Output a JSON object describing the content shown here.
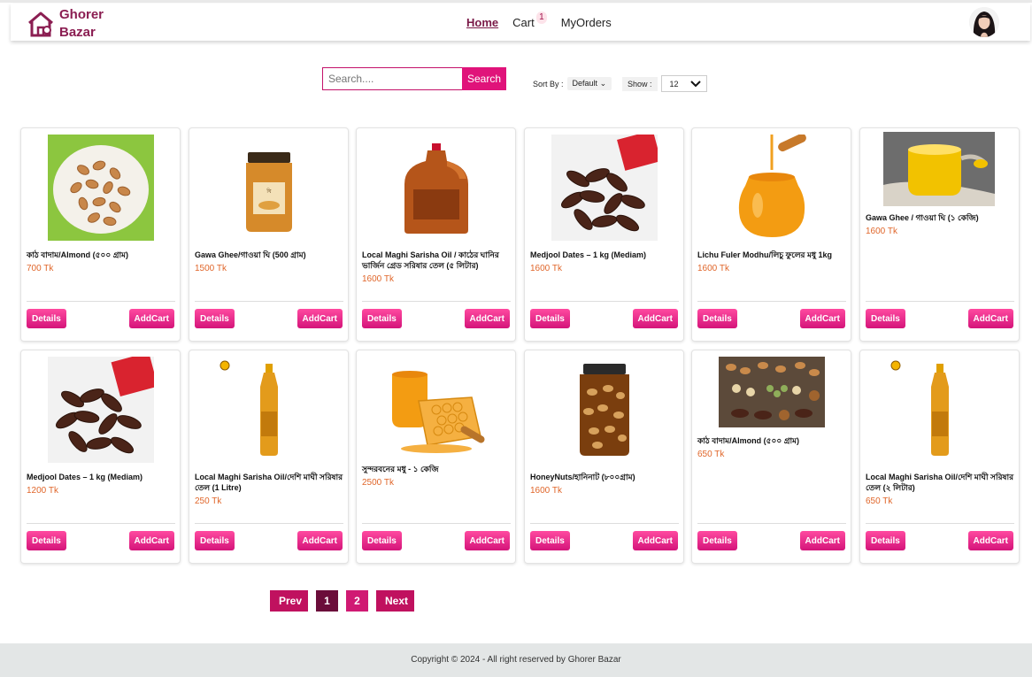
{
  "brand": {
    "line1": "Ghorer",
    "line2": "Bazar",
    "color": "#8b1e52"
  },
  "nav": {
    "home": "Home",
    "cart": "Cart",
    "cart_count": "1",
    "orders": "MyOrders"
  },
  "search": {
    "placeholder": "Search....",
    "button": "Search"
  },
  "sort": {
    "label": "Sort By :",
    "value": "Default"
  },
  "show": {
    "label": "Show :",
    "value": "12"
  },
  "products": [
    {
      "name": "কাঠ বাদাম/Almond (৫০০ গ্রাম)",
      "price": "700 Tk",
      "details": "Details",
      "addcart": "AddCart"
    },
    {
      "name": "Gawa Ghee/গাওয়া ঘি (500 গ্রাম)",
      "price": "1500 Tk",
      "details": "Details",
      "addcart": "AddCart"
    },
    {
      "name": "Local Maghi Sarisha Oil / কাঠের ঘানির ভার্জিন গ্রেড সরিষার তেল (৫ লিটার)",
      "price": "1600 Tk",
      "details": "Details",
      "addcart": "AddCart"
    },
    {
      "name": "Medjool Dates – 1 kg (Mediam)",
      "price": "1600 Tk",
      "details": "Details",
      "addcart": "AddCart"
    },
    {
      "name": "Lichu Fuler Modhu/লিচু ফুলের মধু 1kg",
      "price": "1600 Tk",
      "details": "Details",
      "addcart": "AddCart"
    },
    {
      "name": "Gawa Ghee / গাওয়া ঘি (১ কেজি)",
      "price": "1600 Tk",
      "details": "Details",
      "addcart": "AddCart"
    },
    {
      "name": "Medjool Dates – 1 kg (Mediam)",
      "price": "1200 Tk",
      "details": "Details",
      "addcart": "AddCart"
    },
    {
      "name": "Local Maghi Sarisha Oil/দেশি মাঘী সরিষার তেল (1 Litre)",
      "price": "250 Tk",
      "details": "Details",
      "addcart": "AddCart"
    },
    {
      "name": "সুন্দরবনের মধু - ১ কেজি",
      "price": "2500 Tk",
      "details": "Details",
      "addcart": "AddCart"
    },
    {
      "name": "HoneyNuts/হানিনাট (৮০০গ্রাম)",
      "price": "1600 Tk",
      "details": "Details",
      "addcart": "AddCart"
    },
    {
      "name": "কাঠ বাদাম/Almond (৫০০ গ্রাম)",
      "price": "650 Tk",
      "details": "Details",
      "addcart": "AddCart"
    },
    {
      "name": "Local Maghi Sarisha Oil/দেশি মাঘী সরিষার তেল (২ লিটার)",
      "price": "650 Tk",
      "details": "Details",
      "addcart": "AddCart"
    }
  ],
  "pagination": {
    "prev": "Prev",
    "pages": [
      "1",
      "2"
    ],
    "current": "1",
    "next": "Next"
  },
  "footer": {
    "text": "Copyright © 2024 - All right reserved by Ghorer Bazar"
  },
  "colors": {
    "accent": "#e0137a",
    "price": "#e0662a",
    "pager_active": "#6b0d3a"
  }
}
